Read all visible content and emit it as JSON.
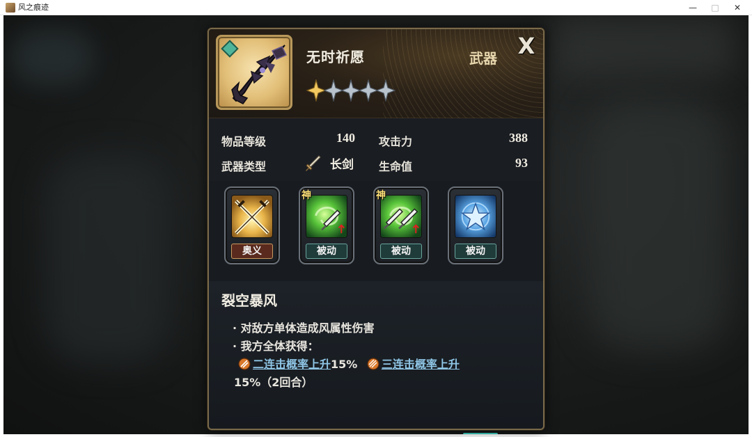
{
  "window": {
    "title": "风之痕迹",
    "minimize": "—",
    "maximize": "□",
    "close": "✕"
  },
  "item": {
    "name": "无时祈愿",
    "type": "武器",
    "close_glyph": "X",
    "stars_total": 5,
    "stars_filled": 1
  },
  "stats": {
    "level_label": "物品等级",
    "level_value": "140",
    "attack_label": "攻击力",
    "attack_value": "388",
    "weapon_type_label": "武器类型",
    "weapon_type_value": "长剑",
    "hp_label": "生命值",
    "hp_value": "93"
  },
  "skills": [
    {
      "tag": "奥义",
      "divine": "",
      "icon": "crossed-swords-icon"
    },
    {
      "tag": "被动",
      "divine": "神",
      "icon": "wind-sword-icon"
    },
    {
      "tag": "被动",
      "divine": "神",
      "icon": "double-sword-icon"
    },
    {
      "tag": "被动",
      "divine": "",
      "icon": "blue-star-icon"
    }
  ],
  "description": {
    "title": "裂空暴风",
    "line1": "· 对敌方单体造成风属性伤害",
    "line2": "· 我方全体获得：",
    "buff1": "二连击概率上升",
    "buff1_value": "15%",
    "buff2": "三连击概率上升",
    "line4": "15%（2回合）"
  },
  "colors": {
    "frame_gold": "#b8985a",
    "link_blue": "#8fc6e6",
    "star_gold": "#f2c860",
    "star_silver": "#b8c2cc"
  }
}
